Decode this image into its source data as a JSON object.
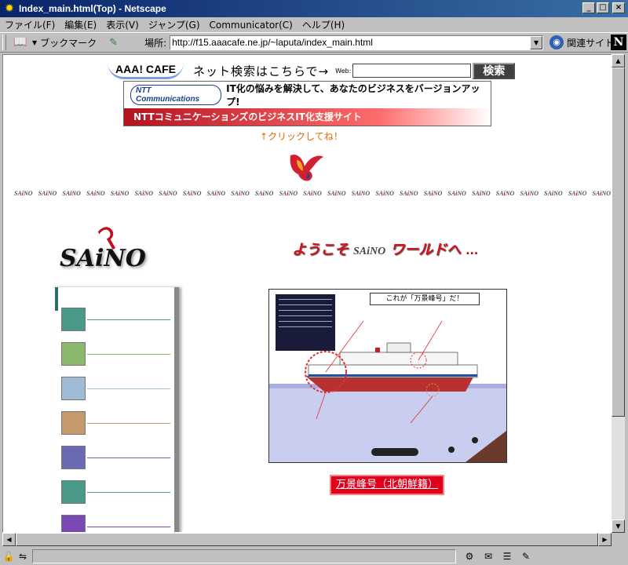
{
  "window": {
    "title": "Index_main.html(Top) - Netscape",
    "controls": {
      "minimize": "_",
      "maximize": "□",
      "close": "×"
    }
  },
  "menu": {
    "items": [
      "ファイル(F)",
      "編集(E)",
      "表示(V)",
      "ジャンプ(G)",
      "Communicator(C)",
      "ヘルプ(H)"
    ]
  },
  "toolbar": {
    "bookmarks_label": "ブックマーク",
    "location_label": "場所:",
    "url": "http://f15.aaacafe.ne.jp/~laputa/index_main.html",
    "related_label": "関連サイト",
    "netscape_logo": "N"
  },
  "page": {
    "search": {
      "logo": "AAA! CAFE",
      "prompt": "ネット検索はこちらで→",
      "web_label": "Web:",
      "field_value": "",
      "button_label": "検索"
    },
    "banner": {
      "logo": "NTT Communications",
      "tagline": "IT化の悩みを解決して、あなたのビジネスをバージョンアップ!",
      "subline": "NTTコミュニケーションズのビジネスIT化支援サイト"
    },
    "click_note": "↑クリックしてね！",
    "strip_logo": "SAiNO",
    "big_logo": "SAiNO",
    "welcome": {
      "part1": "ようこそ",
      "brand": "SAiNO",
      "part2": "ワールドへ",
      "ellipsis": "..."
    },
    "ship_figure": {
      "title": "これが「万景峰号」だ！",
      "caption": "万景峰号（北朝鮮籍）"
    },
    "nav_colors": [
      "#4a9a8a",
      "#8cb86e",
      "#a0bcd4",
      "#c49a6c",
      "#6a6ab4",
      "#4a9a8a",
      "#7a4ab4"
    ]
  },
  "scrollbars": {
    "up": "▲",
    "down": "▼",
    "left": "◀",
    "right": "▶"
  }
}
